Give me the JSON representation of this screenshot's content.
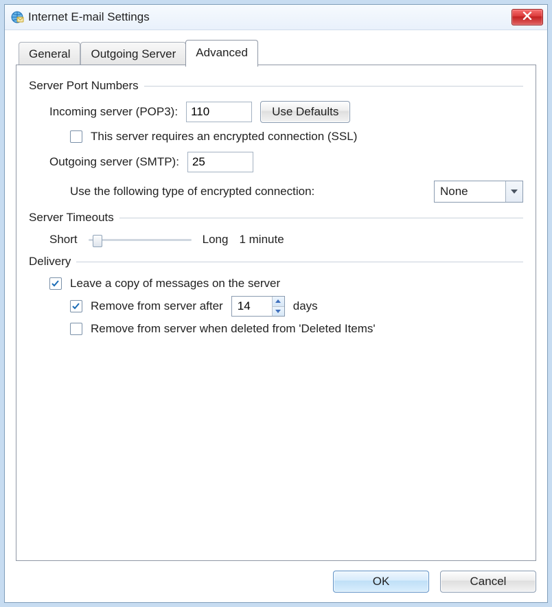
{
  "title": "Internet E-mail Settings",
  "tabs": {
    "general": "General",
    "outgoing": "Outgoing Server",
    "advanced": "Advanced"
  },
  "groups": {
    "ports": {
      "caption": "Server Port Numbers",
      "incoming_label": "Incoming server (POP3):",
      "incoming_value": "110",
      "use_defaults": "Use Defaults",
      "ssl_label": "This server requires an encrypted connection (SSL)",
      "ssl_checked": false,
      "outgoing_label": "Outgoing server (SMTP):",
      "outgoing_value": "25",
      "enc_label": "Use the following type of encrypted connection:",
      "enc_value": "None"
    },
    "timeouts": {
      "caption": "Server Timeouts",
      "short": "Short",
      "long": "Long",
      "value": "1 minute"
    },
    "delivery": {
      "caption": "Delivery",
      "leave_copy": "Leave a copy of messages on the server",
      "leave_copy_checked": true,
      "remove_after_pre": "Remove from server after",
      "remove_after_value": "14",
      "remove_after_days": "days",
      "remove_after_checked": true,
      "remove_deleted": "Remove from server when deleted from 'Deleted Items'",
      "remove_deleted_checked": false
    }
  },
  "buttons": {
    "ok": "OK",
    "cancel": "Cancel"
  }
}
